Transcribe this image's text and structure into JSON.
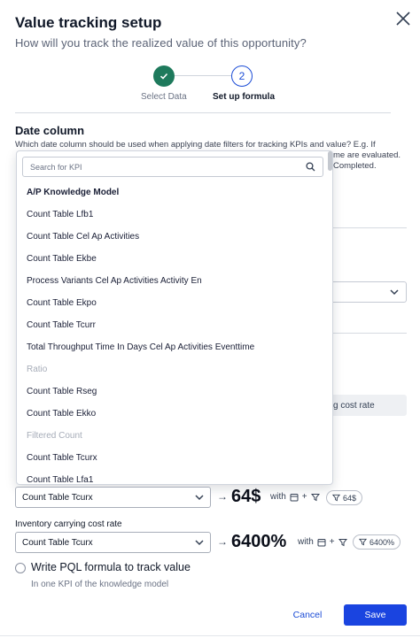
{
  "modal": {
    "title": "Value tracking setup",
    "subtitle": "How will you track the realized value of this opportunity?"
  },
  "stepper": {
    "step1_label": "Select Data",
    "step2_number": "2",
    "step2_label": "Set up formula"
  },
  "date_column": {
    "title": "Date column",
    "description": "Which date column should be used when applying date filters for tracking KPIs and value? E.g. If",
    "frag_line2": "me are evaluated.",
    "frag_line3": "Completed."
  },
  "background": {
    "pill_text": "g cost rate"
  },
  "dropdown": {
    "search_placeholder": "Search for KPI",
    "items": [
      {
        "label": "A/P Knowledge Model",
        "kind": "group"
      },
      {
        "label": "Count Table Lfb1",
        "kind": "item"
      },
      {
        "label": "Count Table Cel Ap Activities",
        "kind": "item"
      },
      {
        "label": "Count Table Ekbe",
        "kind": "item"
      },
      {
        "label": "Process Variants Cel Ap Activities Activity En",
        "kind": "item"
      },
      {
        "label": "Count Table Ekpo",
        "kind": "item"
      },
      {
        "label": "Count Table Tcurr",
        "kind": "item"
      },
      {
        "label": "Total Throughput Time In Days Cel Ap Activities Eventtime",
        "kind": "item"
      },
      {
        "label": "Ratio",
        "kind": "header-disabled"
      },
      {
        "label": "Count Table Rseg",
        "kind": "item"
      },
      {
        "label": "Count Table Ekko",
        "kind": "item"
      },
      {
        "label": "Filtered Count",
        "kind": "header-disabled"
      },
      {
        "label": "Count Table Tcurx",
        "kind": "item"
      },
      {
        "label": "Count Table Lfa1",
        "kind": "item"
      }
    ]
  },
  "row1": {
    "select_value": "Count Table Tcurx",
    "value": "64$",
    "with_label": "with",
    "plus": "+",
    "chip_value": "64$"
  },
  "row2": {
    "label": "Inventory carrying cost rate",
    "select_value": "Count Table Tcurx",
    "value": "6400%",
    "with_label": "with",
    "plus": "+",
    "chip_value": "6400%"
  },
  "pql_option": {
    "label": "Write PQL formula to track value",
    "sub": "In one KPI of the knowledge model"
  },
  "footer": {
    "cancel": "Cancel",
    "save": "Save"
  },
  "colors": {
    "primary": "#1a44e0",
    "success": "#1e7a5c",
    "text": "#101828"
  }
}
